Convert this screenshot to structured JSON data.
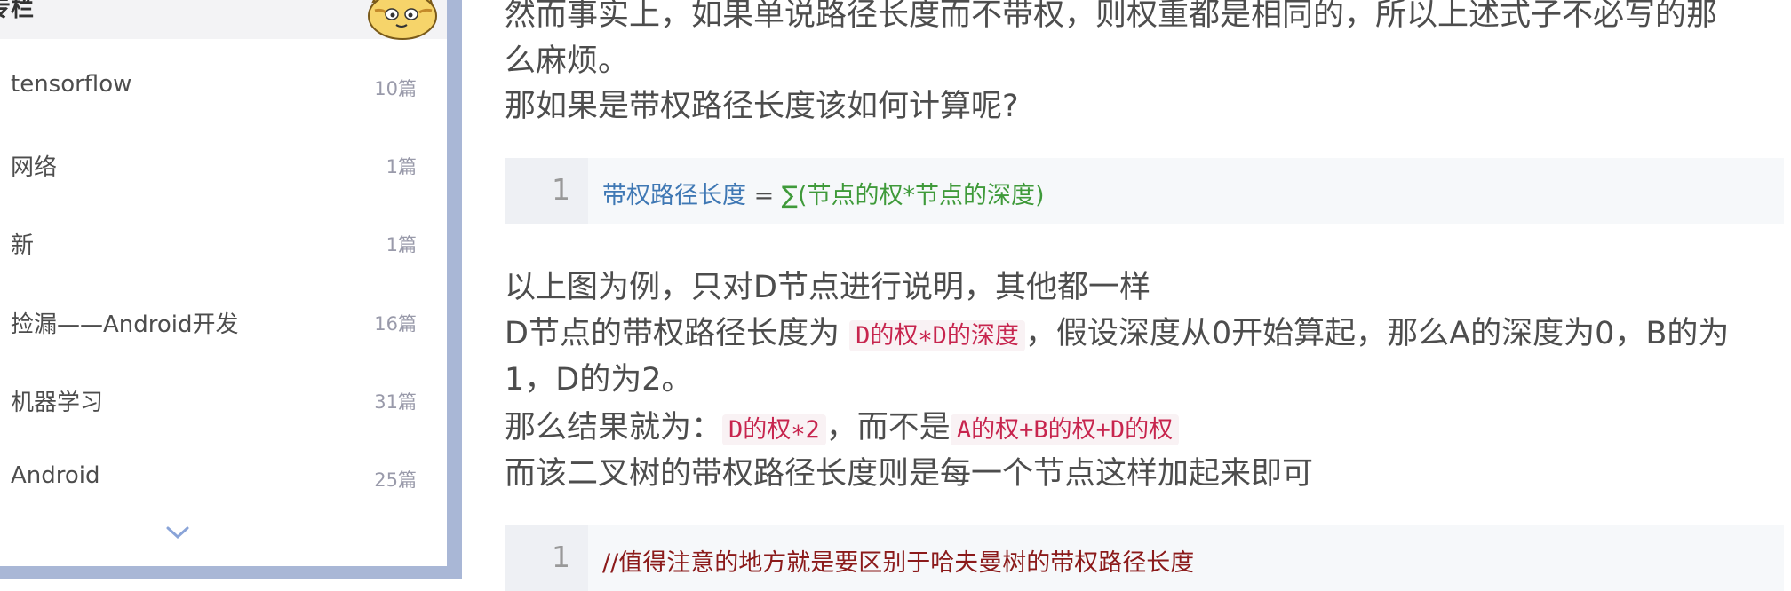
{
  "sidebar": {
    "title": "专栏",
    "categories": [
      {
        "name": "tensorflow",
        "count": "10篇"
      },
      {
        "name": "网络",
        "count": "1篇"
      },
      {
        "name": "新",
        "count": "1篇"
      },
      {
        "name": "捡漏——Android开发",
        "count": "16篇"
      },
      {
        "name": "机器学习",
        "count": "31篇"
      },
      {
        "name": "Android",
        "count": "25篇"
      }
    ],
    "expand_icon": "chevron-down-icon"
  },
  "article": {
    "line1": "然而事实上，如果单说路径长度而不带权，则权重都是相同的，所以上述式子不必写的那",
    "line2": "么麻烦。",
    "line3": "那如果是带权路径长度该如何计算呢?",
    "code1": {
      "line_number": "1",
      "var": "带权路径长度",
      "op": " = ",
      "expr": "∑(节点的权*节点的深度)"
    },
    "line4": "以上图为例，只对D节点进行说明，其他都一样",
    "line5_pre": "D节点的带权路径长度为 ",
    "line5_code": "D的权∗D的深度",
    "line5_post": "，假设深度从0开始算起，那么A的深度为0，B的为",
    "line6": "1，D的为2。",
    "line7_pre": "那么结果就为：",
    "line7_code1": "D的权∗2",
    "line7_mid": "，而不是",
    "line7_code2": "A的权+B的权+D的权",
    "line8": "而该二叉树的带权路径长度则是每一个节点这样加起来即可",
    "code2": {
      "line_number": "1",
      "comment": "//值得注意的地方就是要区别于哈夫曼树的带权路径长度"
    }
  },
  "colors": {
    "page_side_background": "#a9b7d6",
    "inline_code": "#c7254e",
    "code_keyword": "#3f78b4",
    "code_expr": "#3f9a3a",
    "code_comment": "#8b1a1a"
  }
}
